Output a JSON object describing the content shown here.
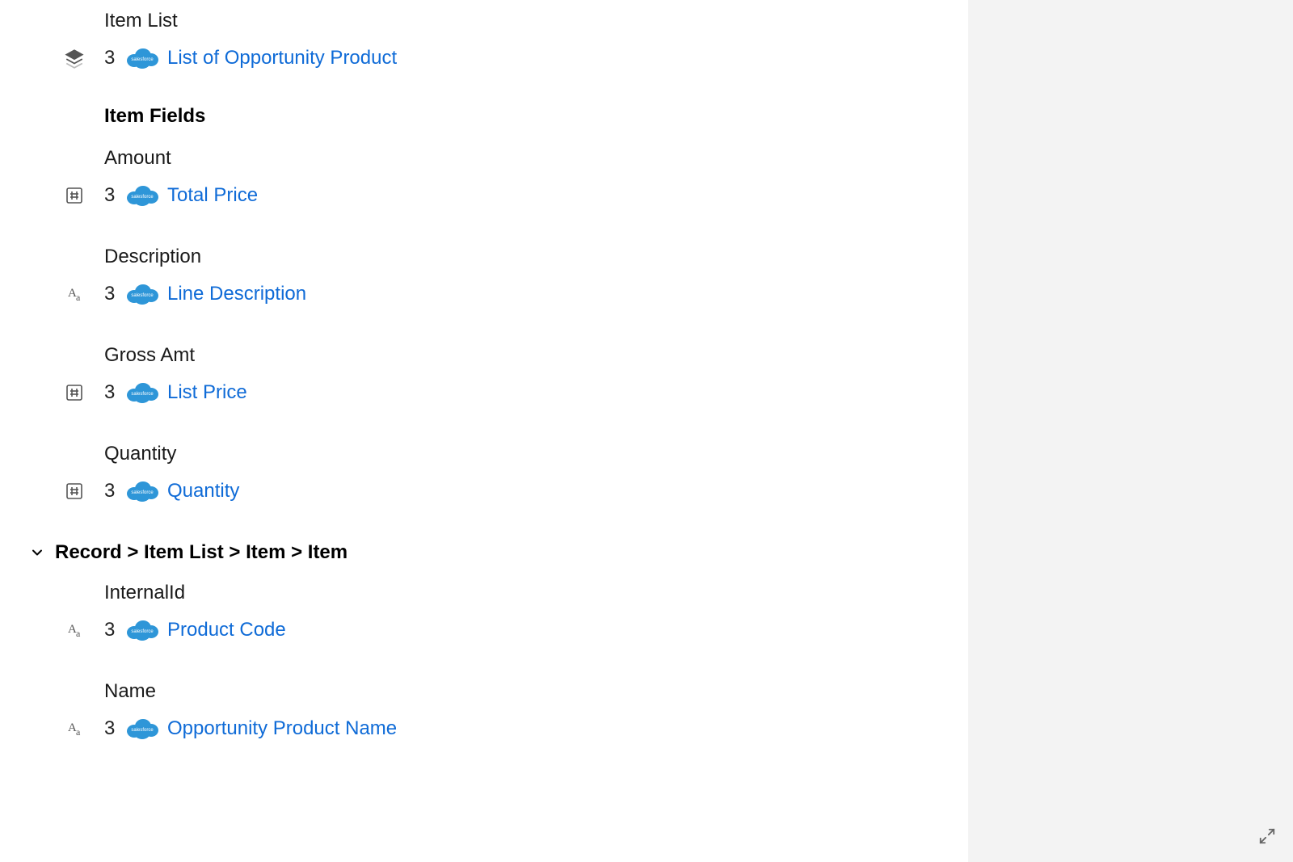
{
  "topSection": {
    "itemListLabel": "Item List",
    "itemListMapping": {
      "step": "3",
      "link": "List of Opportunity Product"
    },
    "itemFieldsHeader": "Item Fields",
    "fields": [
      {
        "label": "Amount",
        "icon": "number",
        "step": "3",
        "link": "Total Price"
      },
      {
        "label": "Description",
        "icon": "text",
        "step": "3",
        "link": "Line Description"
      },
      {
        "label": "Gross Amt",
        "icon": "number",
        "step": "3",
        "link": "List Price"
      },
      {
        "label": "Quantity",
        "icon": "number",
        "step": "3",
        "link": "Quantity"
      }
    ]
  },
  "breadcrumb": "Record > Item List > Item > Item",
  "subSection": {
    "fields": [
      {
        "label": "InternalId",
        "icon": "text",
        "step": "3",
        "link": "Product Code"
      },
      {
        "label": "Name",
        "icon": "text",
        "step": "3",
        "link": "Opportunity Product Name"
      }
    ]
  }
}
